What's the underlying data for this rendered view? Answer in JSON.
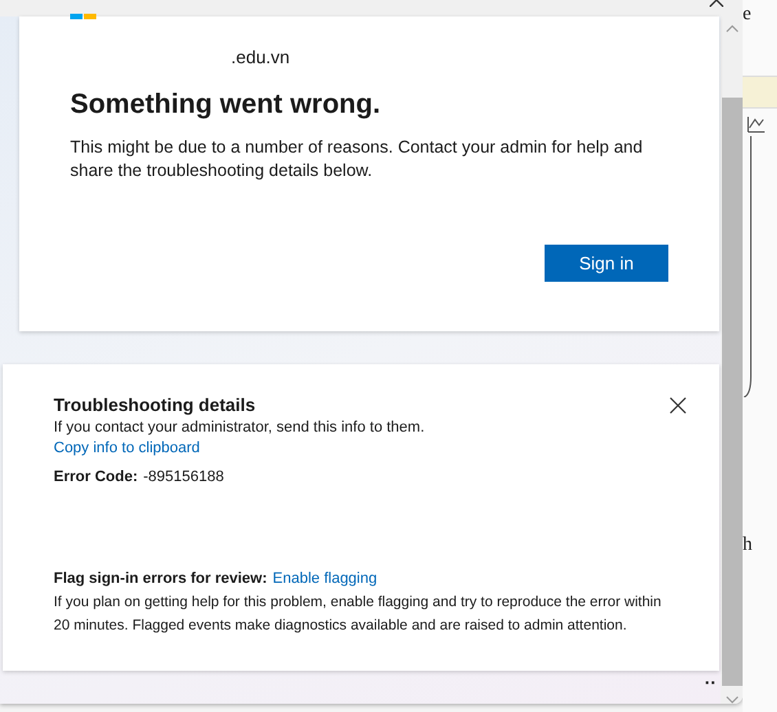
{
  "card": {
    "domain": ".edu.vn",
    "heading": "Something went wrong.",
    "message": "This might be due to a number of reasons. Contact your admin for help and share the troubleshooting details below.",
    "button": "Sign in"
  },
  "troubleshooting": {
    "title": "Troubleshooting details",
    "subtitle": "If you contact your administrator, send this info to them.",
    "copy_link": "Copy info to clipboard",
    "error_code_label": "Error Code:",
    "error_code": "-895156188",
    "flag_label": "Flag sign-in errors for review:",
    "flag_link": "Enable flagging",
    "flag_description": "If you plan on getting help for this problem, enable flagging and try to reproduce the error within 20 minutes. Flagged events make diagnostics available and are raised to admin attention."
  },
  "background_app": {
    "top_text": "e",
    "side_text": "h",
    "more": "··"
  }
}
